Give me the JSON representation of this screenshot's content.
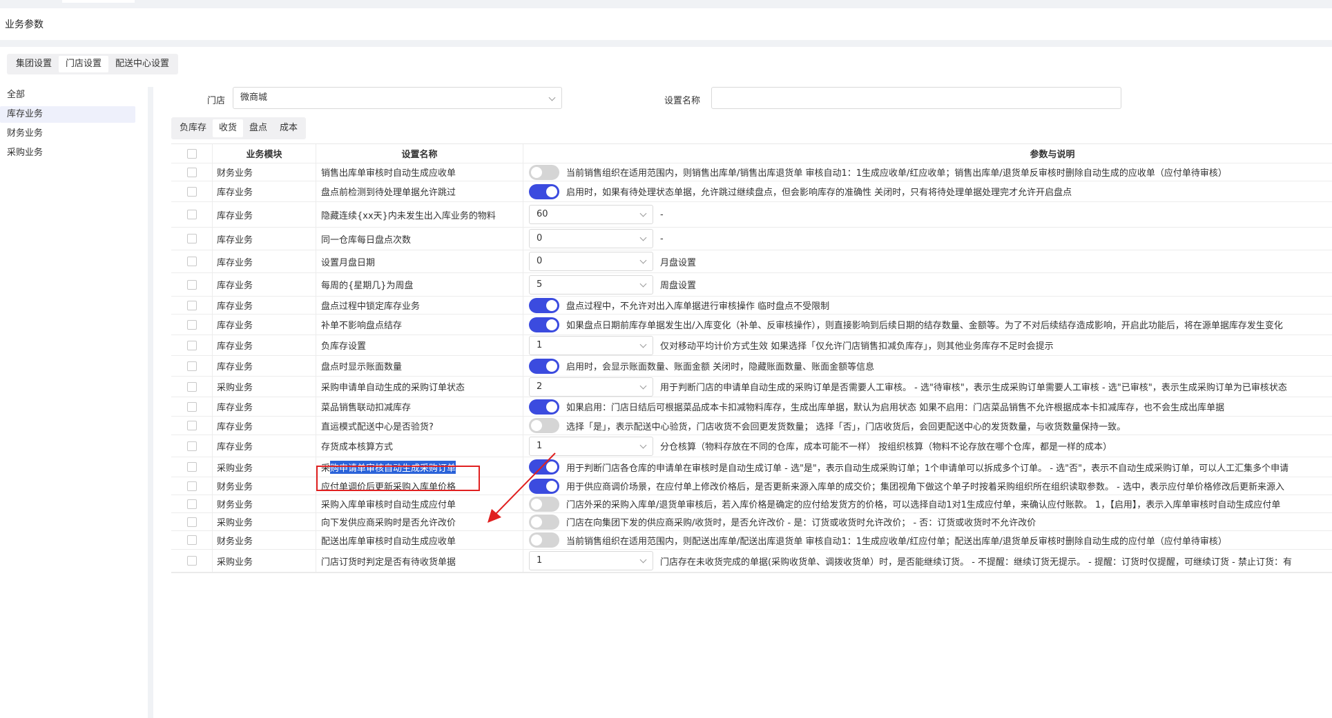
{
  "page": {
    "title": "业务参数"
  },
  "subtabs": [
    {
      "label": "集团设置",
      "active": false
    },
    {
      "label": "门店设置",
      "active": true
    },
    {
      "label": "配送中心设置",
      "active": false
    }
  ],
  "sidenav": [
    {
      "label": "全部",
      "active": false
    },
    {
      "label": "库存业务",
      "active": true
    },
    {
      "label": "财务业务",
      "active": false
    },
    {
      "label": "采购业务",
      "active": false
    }
  ],
  "filters": {
    "store_label": "门店",
    "store_value": "微商城",
    "name_label": "设置名称",
    "name_value": ""
  },
  "cattabs": [
    {
      "label": "负库存",
      "active": false
    },
    {
      "label": "收货",
      "active": true
    },
    {
      "label": "盘点",
      "active": false
    },
    {
      "label": "成本",
      "active": false
    }
  ],
  "table": {
    "headers": {
      "module": "业务模块",
      "name": "设置名称",
      "desc": "参数与说明"
    },
    "rows": [
      {
        "module": "财务业务",
        "name": "销售出库单审核时自动生成应收单",
        "control": "toggle",
        "on": false,
        "desc": "当前销售组织在适用范围内，则销售出库单/销售出库退货单 审核自动1：1生成应收单/红应收单；销售出库单/退货单反审核时删除自动生成的应收单（应付单待审核）"
      },
      {
        "module": "库存业务",
        "name": "盘点前检测到待处理单据允许跳过",
        "control": "toggle",
        "on": true,
        "desc": "启用时，如果有待处理状态单据，允许跳过继续盘点，但会影响库存的准确性 关闭时，只有将待处理单据处理完才允许开启盘点"
      },
      {
        "module": "库存业务",
        "name": "隐藏连续{xx天}内未发生出入库业务的物料",
        "control": "select",
        "value": "60",
        "desc": "-"
      },
      {
        "module": "库存业务",
        "name": "同一仓库每日盘点次数",
        "control": "select",
        "value": "0",
        "desc": "-"
      },
      {
        "module": "库存业务",
        "name": "设置月盘日期",
        "control": "select",
        "value": "0",
        "desc": "月盘设置"
      },
      {
        "module": "库存业务",
        "name": "每周的{星期几}为周盘",
        "control": "select",
        "value": "5",
        "desc": "周盘设置"
      },
      {
        "module": "库存业务",
        "name": "盘点过程中锁定库存业务",
        "control": "toggle",
        "on": true,
        "desc": "盘点过程中，不允许对出入库单据进行审核操作 临时盘点不受限制"
      },
      {
        "module": "库存业务",
        "name": "补单不影响盘点结存",
        "control": "toggle",
        "on": true,
        "desc": "如果盘点日期前库存单据发生出/入库变化（补单、反审核操作），则直接影响到后续日期的结存数量、金额等。为了不对后续结存造成影响，开启此功能后，将在源单据库存发生变化"
      },
      {
        "module": "库存业务",
        "name": "负库存设置",
        "control": "select",
        "value": "1",
        "desc": "仅对移动平均计价方式生效 如果选择「仅允许门店销售扣减负库存」，则其他业务库存不足时会提示"
      },
      {
        "module": "库存业务",
        "name": "盘点时显示账面数量",
        "control": "toggle",
        "on": true,
        "desc": "启用时，会显示账面数量、账面金额 关闭时，隐藏账面数量、账面金额等信息"
      },
      {
        "module": "采购业务",
        "name": "采购申请单自动生成的采购订单状态",
        "control": "select",
        "value": "2",
        "desc": "用于判断门店的申请单自动生成的采购订单是否需要人工审核。 - 选\"待审核\"，表示生成采购订单需要人工审核 - 选\"已审核\"，表示生成采购订单为已审核状态"
      },
      {
        "module": "库存业务",
        "name": "菜品销售联动扣减库存",
        "control": "toggle",
        "on": true,
        "desc": "如果启用：门店日结后可根据菜品成本卡扣减物料库存，生成出库单据，默认为启用状态 如果不启用：门店菜品销售不允许根据成本卡扣减库存，也不会生成出库单据"
      },
      {
        "module": "库存业务",
        "name": "直运模式配送中心是否验货?",
        "control": "toggle",
        "on": false,
        "desc": "选择「是」，表示配送中心验货，门店收货不会回更发货数量； 选择「否」，门店收货后，会回更配送中心的发货数量，与收货数量保持一致。"
      },
      {
        "module": "库存业务",
        "name": "存货成本核算方式",
        "control": "select",
        "value": "1",
        "desc": "分仓核算（物料存放在不同的仓库，成本可能不一样） 按组织核算（物料不论存放在哪个仓库，都是一样的成本）"
      },
      {
        "module": "采购业务",
        "name_prefix": "采",
        "name": "购申请单审核自动生成采购订单",
        "control": "toggle",
        "on": true,
        "highlight": true,
        "desc": "用于判断门店各仓库的申请单在审核时是自动生成订单 - 选\"是\"，表示自动生成采购订单；1个申请单可以拆成多个订单。 - 选\"否\"，表示不自动生成采购订单，可以人工汇集多个申请"
      },
      {
        "module": "财务业务",
        "name": "应付单调价后更新采购入库单价格",
        "control": "toggle",
        "on": true,
        "desc": "用于供应商调价场景，在应付单上修改价格后，是否更新来源入库单的成交价；集团视角下做这个单子时按着采购组织所在组织读取参数。 - 选中，表示应付单价格修改后更新来源入"
      },
      {
        "module": "财务业务",
        "name": "采购入库单审核时自动生成应付单",
        "control": "toggle",
        "on": false,
        "desc": "门店外采的采购入库单/退货单审核后，若入库价格是确定的应付给发货方的价格，可以选择自动1对1生成应付单，来确认应付账款。 1，【启用】，表示入库单审核时自动生成应付单"
      },
      {
        "module": "采购业务",
        "name": "向下发供应商采购时是否允许改价",
        "control": "toggle",
        "on": false,
        "desc": "门店在向集团下发的供应商采购/收货时，是否允许改价 - 是：订货或收货时允许改价； - 否：订货或收货时不允许改价"
      },
      {
        "module": "财务业务",
        "name": "配送出库单审核时自动生成应收单",
        "control": "toggle",
        "on": false,
        "desc": "当前销售组织在适用范围内，则配送出库单/配送出库退货单 审核自动1：1生成应收单/红应付单；配送出库单/退货单反审核时删除自动生成的应付单（应付单待审核）"
      },
      {
        "module": "采购业务",
        "name": "门店订货时判定是否有待收货单据",
        "control": "select",
        "value": "1",
        "desc": "门店存在未收货完成的单据(采购收货单、调拨收货单）时，是否能继续订货。 - 不提醒：继续订货无提示。 - 提醒：订货时仅提醒，可继续订货 - 禁止订货：有"
      }
    ]
  }
}
